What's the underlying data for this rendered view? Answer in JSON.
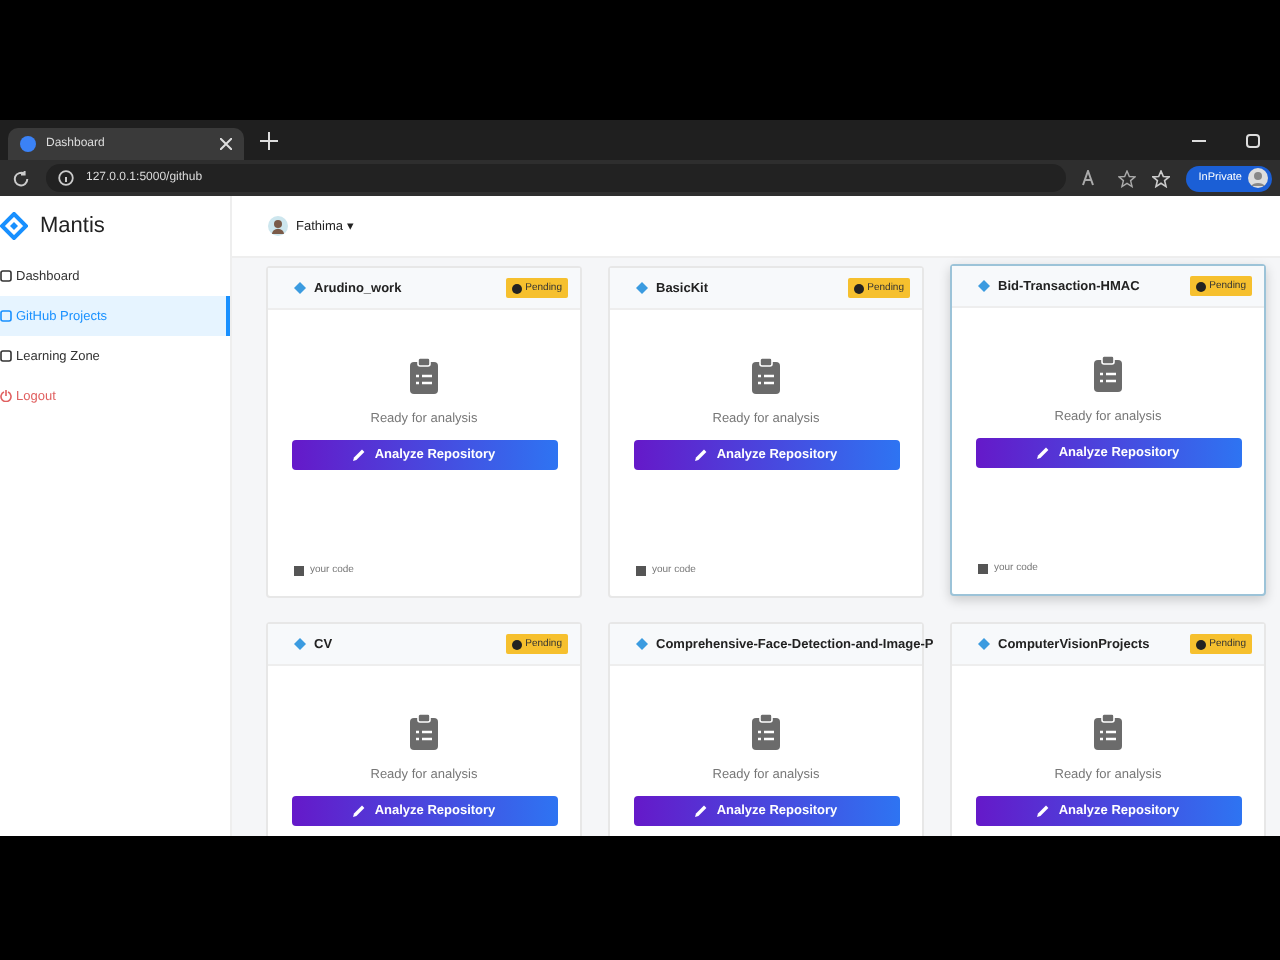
{
  "browser": {
    "tabs": [
      {
        "title": "Dashboard",
        "selected": true
      }
    ],
    "address": "127.0.0.1:5000/github",
    "profile_badge": "InPrivate"
  },
  "app": {
    "brand": "Mantis",
    "user": "Fathima ▾"
  },
  "sidebar": {
    "items": [
      {
        "label": "Dashboard",
        "selected": false,
        "kind": "nav"
      },
      {
        "label": "GitHub Projects",
        "selected": true,
        "kind": "nav"
      },
      {
        "label": "Learning Zone",
        "selected": false,
        "kind": "nav"
      },
      {
        "label": "Logout",
        "selected": false,
        "kind": "logout"
      }
    ]
  },
  "projects": [
    {
      "name": "Arudino_work",
      "status": "Pending",
      "message": "Ready for analysis",
      "action": "Analyze Repository",
      "footer": "your code",
      "hovered": false
    },
    {
      "name": "BasicKit",
      "status": "Pending",
      "message": "Ready for analysis",
      "action": "Analyze Repository",
      "footer": "your code",
      "hovered": false
    },
    {
      "name": "Bid-Transaction-HMAC",
      "status": "Pending",
      "message": "Ready for analysis",
      "action": "Analyze Repository",
      "footer": "your code",
      "hovered": true
    },
    {
      "name": "CV",
      "status": "Pending",
      "message": "Ready for analysis",
      "action": "Analyze Repository",
      "hovered": false
    },
    {
      "name": "Comprehensive-Face-Detection-and-Image-P",
      "message": "Ready for analysis",
      "action": "Analyze Repository",
      "hovered": false
    },
    {
      "name": "ComputerVisionProjects",
      "status": "Pending",
      "message": "Ready for analysis",
      "action": "Analyze Repository",
      "hovered": false
    }
  ]
}
